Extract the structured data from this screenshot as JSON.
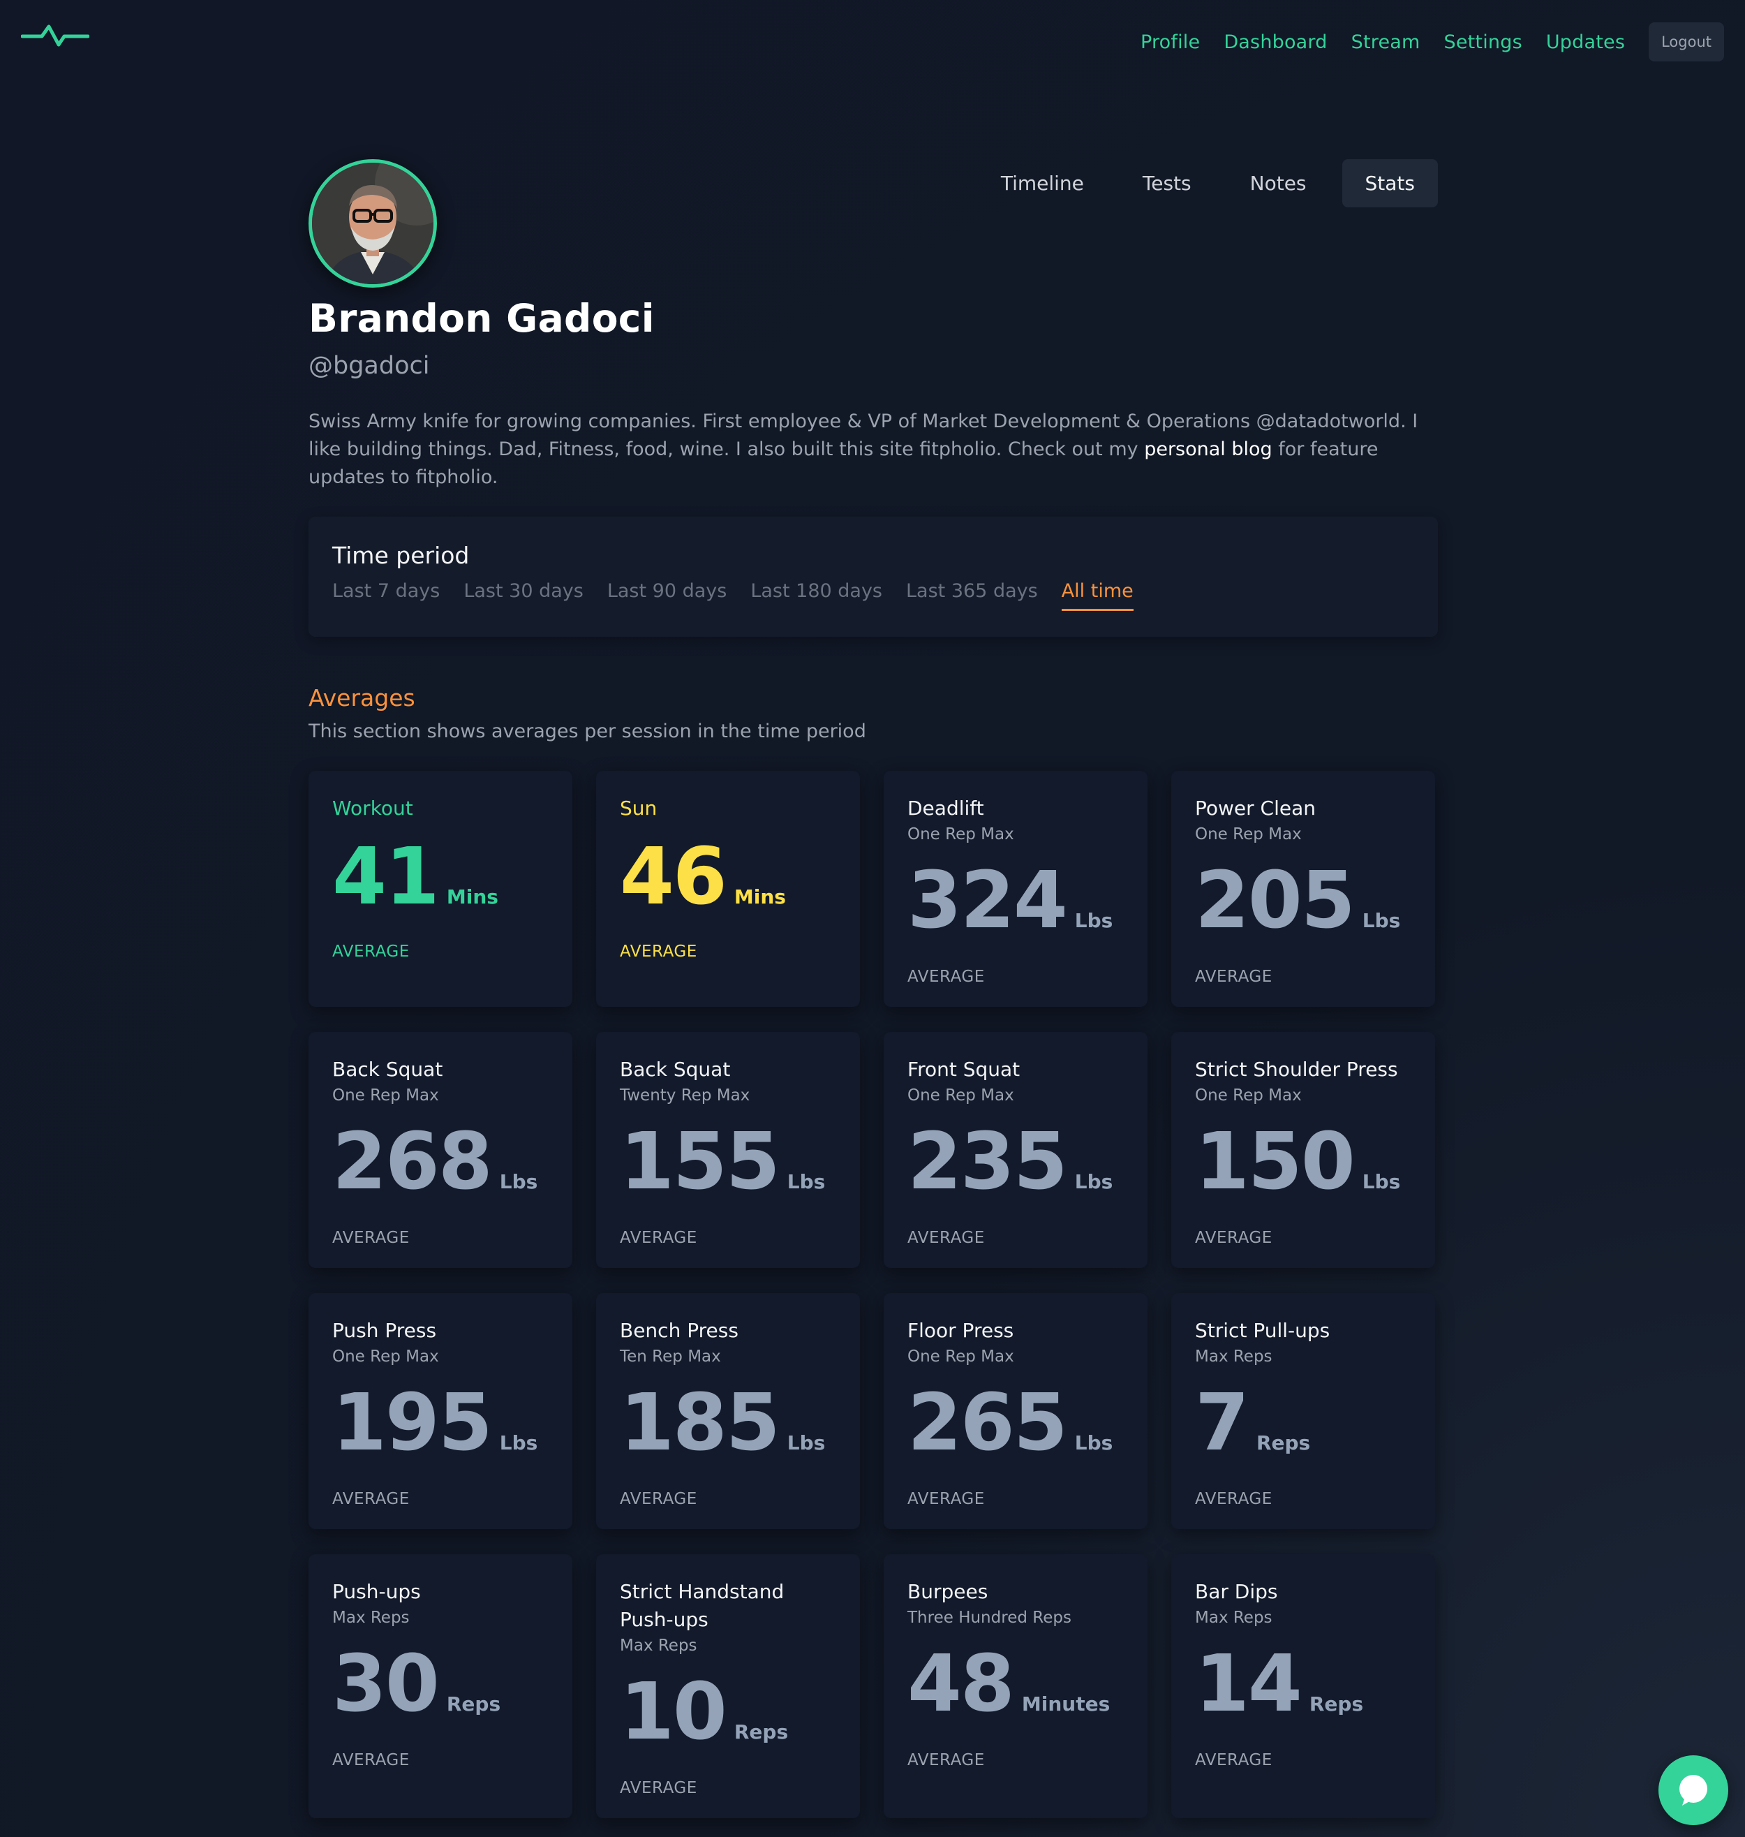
{
  "nav": {
    "items": [
      "Profile",
      "Dashboard",
      "Stream",
      "Settings",
      "Updates"
    ],
    "logout_label": "Logout",
    "logo_icon": "pulse-icon"
  },
  "profile": {
    "name": "Brandon Gadoci",
    "handle": "@bgadoci",
    "bio_before": "Swiss Army knife for growing companies. First employee & VP of Market Development & Operations @datadotworld. I like building things. Dad, Fitness, food, wine. I also built this site fitpholio. Check out my ",
    "bio_link": "personal blog",
    "bio_after": " for feature updates to fitpholio.",
    "tabs": [
      "Timeline",
      "Tests",
      "Notes",
      "Stats"
    ],
    "active_tab": "Stats"
  },
  "time_period": {
    "title": "Time period",
    "options": [
      "Last 7 days",
      "Last 30 days",
      "Last 90 days",
      "Last 180 days",
      "Last 365 days",
      "All time"
    ],
    "selected": "All time"
  },
  "averages": {
    "title": "Averages",
    "subtitle": "This section shows averages per session in the time period",
    "cards": [
      {
        "title": "Workout",
        "subtitle": "",
        "value": "41",
        "unit": "Mins",
        "label": "AVERAGE",
        "accent": "green"
      },
      {
        "title": "Sun",
        "subtitle": "",
        "value": "46",
        "unit": "Mins",
        "label": "AVERAGE",
        "accent": "yellow"
      },
      {
        "title": "Deadlift",
        "subtitle": "One Rep Max",
        "value": "324",
        "unit": "Lbs",
        "label": "AVERAGE",
        "accent": ""
      },
      {
        "title": "Power Clean",
        "subtitle": "One Rep Max",
        "value": "205",
        "unit": "Lbs",
        "label": "AVERAGE",
        "accent": ""
      },
      {
        "title": "Back Squat",
        "subtitle": "One Rep Max",
        "value": "268",
        "unit": "Lbs",
        "label": "AVERAGE",
        "accent": ""
      },
      {
        "title": "Back Squat",
        "subtitle": "Twenty Rep Max",
        "value": "155",
        "unit": "Lbs",
        "label": "AVERAGE",
        "accent": ""
      },
      {
        "title": "Front Squat",
        "subtitle": "One Rep Max",
        "value": "235",
        "unit": "Lbs",
        "label": "AVERAGE",
        "accent": ""
      },
      {
        "title": "Strict Shoulder Press",
        "subtitle": "One Rep Max",
        "value": "150",
        "unit": "Lbs",
        "label": "AVERAGE",
        "accent": ""
      },
      {
        "title": "Push Press",
        "subtitle": "One Rep Max",
        "value": "195",
        "unit": "Lbs",
        "label": "AVERAGE",
        "accent": ""
      },
      {
        "title": "Bench Press",
        "subtitle": "Ten Rep Max",
        "value": "185",
        "unit": "Lbs",
        "label": "AVERAGE",
        "accent": ""
      },
      {
        "title": "Floor Press",
        "subtitle": "One Rep Max",
        "value": "265",
        "unit": "Lbs",
        "label": "AVERAGE",
        "accent": ""
      },
      {
        "title": "Strict Pull-ups",
        "subtitle": "Max Reps",
        "value": "7",
        "unit": "Reps",
        "label": "AVERAGE",
        "accent": ""
      },
      {
        "title": "Push-ups",
        "subtitle": "Max Reps",
        "value": "30",
        "unit": "Reps",
        "label": "AVERAGE",
        "accent": ""
      },
      {
        "title": "Strict Handstand Push-ups",
        "subtitle": "Max Reps",
        "value": "10",
        "unit": "Reps",
        "label": "AVERAGE",
        "accent": ""
      },
      {
        "title": "Burpees",
        "subtitle": "Three Hundred Reps",
        "value": "48",
        "unit": "Minutes",
        "label": "AVERAGE",
        "accent": ""
      },
      {
        "title": "Bar Dips",
        "subtitle": "Max Reps",
        "value": "14",
        "unit": "Reps",
        "label": "AVERAGE",
        "accent": ""
      }
    ]
  },
  "colors": {
    "accent_green": "#34d399",
    "accent_yellow": "#fde047",
    "accent_orange": "#fb923c",
    "background": "#111726",
    "card": "#121a2b"
  },
  "chat_icon": "chat-bubble-icon"
}
